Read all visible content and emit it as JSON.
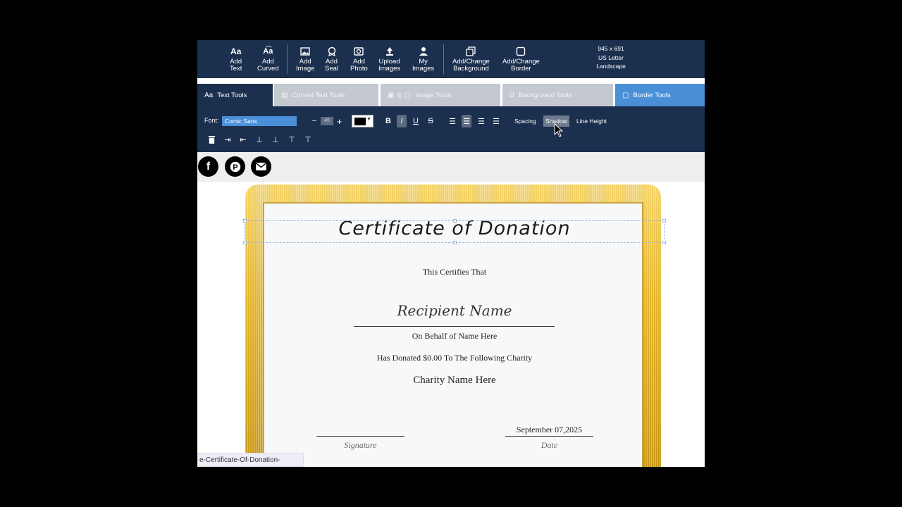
{
  "toolbar": {
    "items": [
      {
        "label1": "Add",
        "label2": "Text",
        "icon": "font-aa-icon"
      },
      {
        "label1": "Add",
        "label2": "Curved",
        "icon": "curved-text-icon"
      },
      {
        "label1": "Add",
        "label2": "Image",
        "icon": "image-icon"
      },
      {
        "label1": "Add",
        "label2": "Seal",
        "icon": "seal-icon"
      },
      {
        "label1": "Add",
        "label2": "Photo",
        "icon": "photo-icon"
      },
      {
        "label1": "Upload",
        "label2": "Images",
        "icon": "upload-icon"
      },
      {
        "label1": "My",
        "label2": "Images",
        "icon": "user-icon"
      },
      {
        "label1": "Add/Change",
        "label2": "Background",
        "icon": "background-icon"
      },
      {
        "label1": "Add/Change",
        "label2": "Border",
        "icon": "border-icon"
      }
    ],
    "dimensions": "945 x 691",
    "paper": "US Letter",
    "orientation": "Landscape"
  },
  "tabs": [
    {
      "label": "Text Tools",
      "icon": "Aa"
    },
    {
      "label": "Curved Text Tools"
    },
    {
      "label": "Image Tools"
    },
    {
      "label": "Background Tools"
    },
    {
      "label": "Border Tools"
    }
  ],
  "text_tools": {
    "font_label": "Font:",
    "font_value": "Comic Sans",
    "font_size": "45",
    "minus": "−",
    "plus": "+",
    "text_color": "#000000",
    "spacing_label": "Spacing",
    "shadow_label": "Shadow",
    "line_height_label": "Line Height"
  },
  "certificate": {
    "title": "Certificate of Donation",
    "certifies": "This Certifies That",
    "recipient": "Recipient Name",
    "on_behalf": "On Behalf of Name Here",
    "donated": "Has Donated $0.00 To The Following Charity",
    "charity": "Charity Name Here",
    "date_value": "September 07,2025",
    "signature_label": "Signature",
    "date_label": "Date"
  },
  "status_url": "e-Certificate-Of-Donation-",
  "colors": {
    "toolbar_bg": "#1b2f4e",
    "active_blue": "#4a90d9",
    "gold": "#e2b52e"
  }
}
